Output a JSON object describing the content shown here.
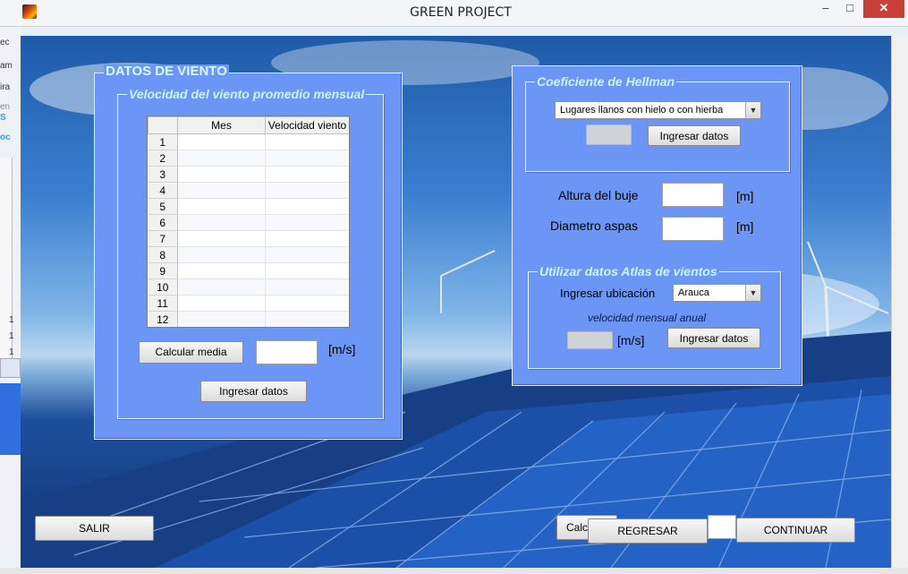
{
  "window": {
    "title": "GREEN PROJECT",
    "minimize": "–",
    "maximize": "□",
    "close": "✕"
  },
  "background_window": {
    "texts": [
      "ec",
      "am",
      "ira",
      "en",
      "S",
      "oc",
      "1",
      "1",
      "1"
    ]
  },
  "wind_panel": {
    "title": "DATOS DE VIENTO",
    "group_title": "Velocidad del viento promedio mensual",
    "table": {
      "headers": [
        "Mes",
        "Velocidad viento"
      ],
      "rows": [
        "1",
        "2",
        "3",
        "4",
        "5",
        "6",
        "7",
        "8",
        "9",
        "10",
        "11",
        "12"
      ]
    },
    "calc_mean_button": "Calcular media",
    "mean_value": "",
    "unit": "[m/s]",
    "submit_button": "Ingresar datos"
  },
  "hellman_panel": {
    "group_title": "Coeficiente de Hellman",
    "terrain_select": "Lugares llanos con hielo o con hierba",
    "coefficient_value": "",
    "submit_button": "Ingresar datos",
    "hub_height_label": "Altura del buje",
    "hub_height_value": "",
    "hub_unit": "[m]",
    "blade_diameter_label": "Diametro aspas",
    "blade_diameter_value": "",
    "blade_unit": "[m]",
    "atlas_group_title": "Utilizar datos Atlas de vientos",
    "location_label": "Ingresar ubicación",
    "location_select": "Arauca",
    "annual_speed_label": "velocidad mensual anual",
    "annual_speed_value": "",
    "annual_unit": "[m/s]",
    "atlas_submit_button": "Ingresar datos"
  },
  "footer": {
    "exit_button": "SALIR",
    "hidden_button": "Calcu",
    "back_button": "REGRESAR",
    "continue_button": "CONTINUAR"
  },
  "colors": {
    "panel": "#6b96f5",
    "legend_text": "#c9f5ff",
    "close": "#c7413a"
  }
}
